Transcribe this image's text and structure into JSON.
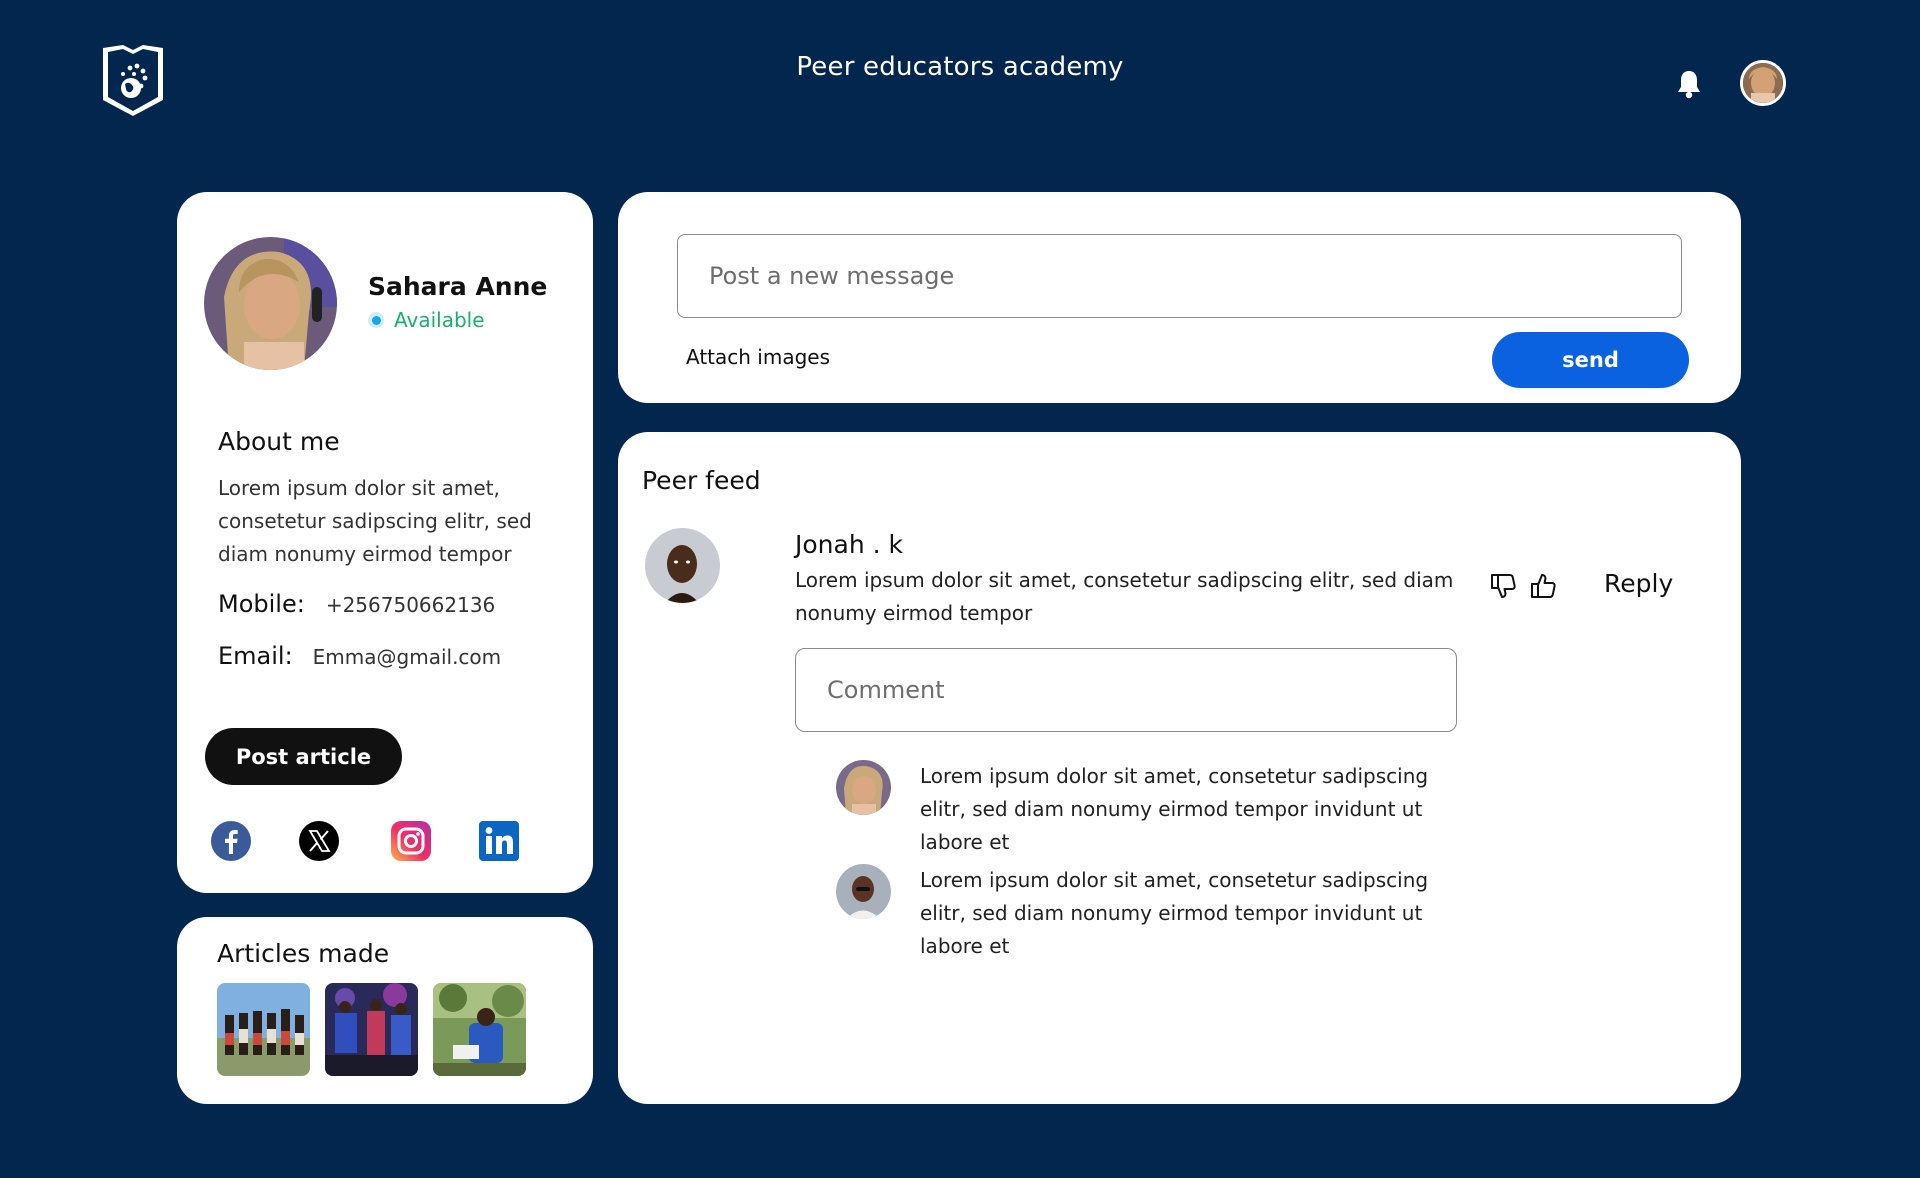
{
  "header": {
    "title": "Peer educators academy",
    "logo_icon": "shield-globe-icon",
    "notification_icon": "bell-icon",
    "user_avatar": "user-avatar"
  },
  "profile": {
    "name": "Sahara Anne",
    "status": "Available",
    "status_color": "#1fae6a",
    "about_title": "About me",
    "about_text": "Lorem ipsum dolor sit amet, consetetur sadipscing elitr, sed diam nonumy eirmod tempor",
    "mobile_label": "Mobile:",
    "mobile": "+256750662136",
    "email_label": "Email:",
    "email": "Emma@gmail.com",
    "post_article_label": "Post  article",
    "socials": [
      "facebook-icon",
      "x-icon",
      "instagram-icon",
      "linkedin-icon"
    ]
  },
  "articles": {
    "title": "Articles made",
    "thumbnails": [
      "article-thumb-group-photo",
      "article-thumb-performance",
      "article-thumb-outdoor-reading"
    ]
  },
  "composer": {
    "placeholder": "Post a new message",
    "attach_label": "Attach images",
    "send_label": "send",
    "send_color": "#0b62e0"
  },
  "feed": {
    "title": "Peer feed",
    "post": {
      "author": "Jonah . k",
      "body": "Lorem ipsum dolor sit amet, consetetur sadipscing elitr, sed diam nonumy eirmod tempor",
      "reply_label": "Reply",
      "comment_placeholder": "Comment"
    },
    "replies": [
      {
        "text": "Lorem ipsum dolor sit amet, consetetur sadipscing elitr, sed diam nonumy eirmod tempor invidunt ut labore et"
      },
      {
        "text": "Lorem ipsum dolor sit amet, consetetur sadipscing elitr, sed diam nonumy eirmod tempor invidunt ut labore et"
      }
    ]
  },
  "colors": {
    "background": "#03264f",
    "card": "#ffffff",
    "primary_button": "#111111"
  }
}
